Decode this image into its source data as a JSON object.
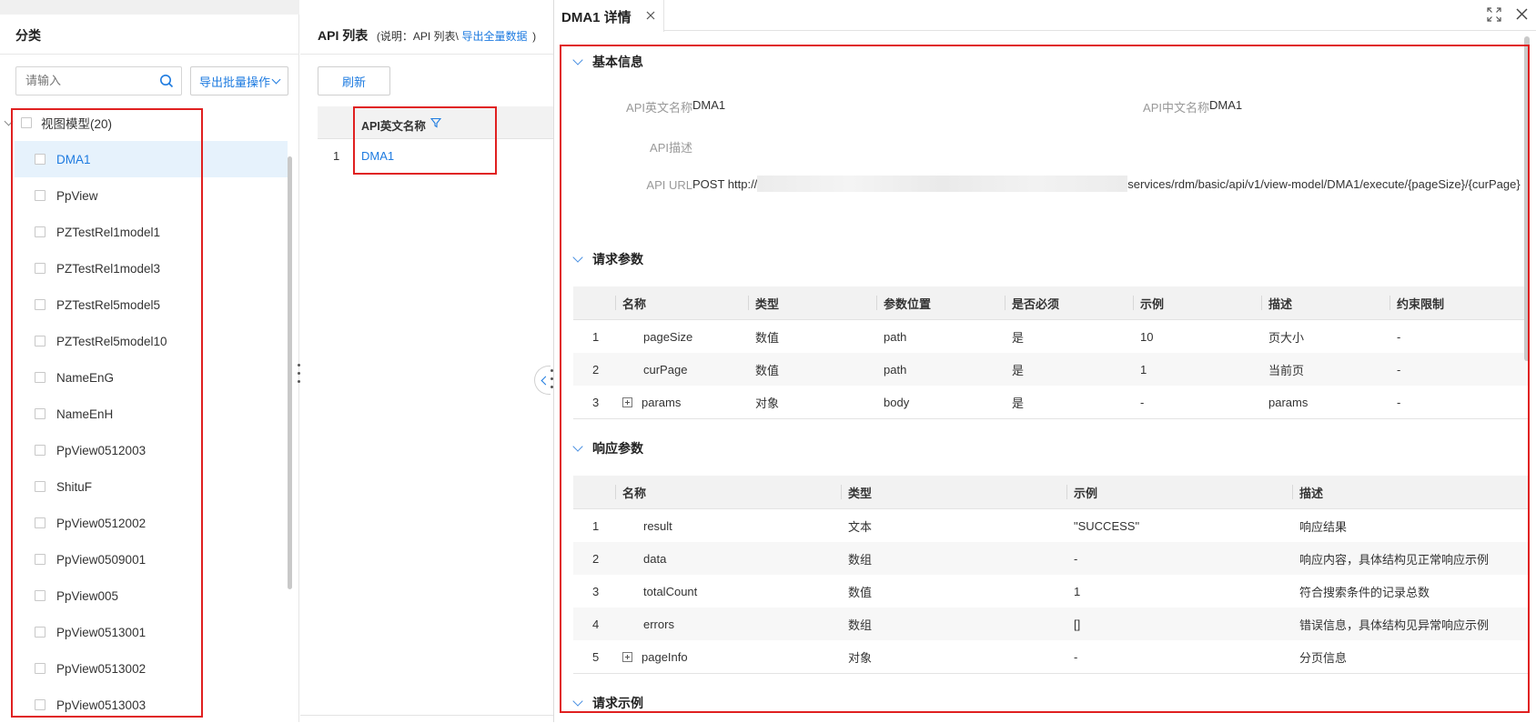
{
  "left_panel": {
    "title": "分类",
    "search_placeholder": "请输入",
    "export_batch_label": "导出批量操作",
    "tree_root_label": "视图模型(20)",
    "tree_items": [
      "DMA1",
      "PpView",
      "PZTestRel1model1",
      "PZTestRel1model3",
      "PZTestRel5model5",
      "PZTestRel5model10",
      "NameEnG",
      "NameEnH",
      "PpView0512003",
      "ShituF",
      "PpView0512002",
      "PpView0509001",
      "PpView005",
      "PpView0513001",
      "PpView0513002",
      "PpView0513003"
    ]
  },
  "middle_panel": {
    "title": "API 列表",
    "note_prefix": "(说明：API 列表\\",
    "note_link": "导出全量数据",
    "note_suffix": ")",
    "refresh_label": "刷新",
    "column_header": "API英文名称",
    "rows": [
      {
        "index": "1",
        "name": "DMA1"
      }
    ]
  },
  "detail_panel": {
    "tab_title": "DMA1 详情",
    "basic": {
      "title": "基本信息",
      "api_en_label": "API英文名称",
      "api_en_value": "DMA1",
      "api_cn_label": "API中文名称",
      "api_cn_value": "DMA1",
      "api_desc_label": "API描述",
      "api_url_label": "API URL",
      "api_url_prefix": "POST http://",
      "api_url_suffix": "services/rdm/basic/api/v1/view-model/DMA1/execute/{pageSize}/{curPage}"
    },
    "request": {
      "title": "请求参数",
      "headers": [
        "名称",
        "类型",
        "参数位置",
        "是否必须",
        "示例",
        "描述",
        "约束限制"
      ],
      "rows": [
        {
          "idx": "1",
          "name": "pageSize",
          "type": "数值",
          "location": "path",
          "required": "是",
          "example": "10",
          "desc": "页大小",
          "constraint": "-",
          "expandable": false
        },
        {
          "idx": "2",
          "name": "curPage",
          "type": "数值",
          "location": "path",
          "required": "是",
          "example": "1",
          "desc": "当前页",
          "constraint": "-",
          "expandable": false
        },
        {
          "idx": "3",
          "name": "params",
          "type": "对象",
          "location": "body",
          "required": "是",
          "example": "-",
          "desc": "params",
          "constraint": "-",
          "expandable": true
        }
      ]
    },
    "response": {
      "title": "响应参数",
      "headers": [
        "名称",
        "类型",
        "示例",
        "描述"
      ],
      "rows": [
        {
          "idx": "1",
          "name": "result",
          "type": "文本",
          "example": "\"SUCCESS\"",
          "desc": "响应结果",
          "expandable": false
        },
        {
          "idx": "2",
          "name": "data",
          "type": "数组",
          "example": "-",
          "desc": "响应内容，具体结构见正常响应示例",
          "expandable": false
        },
        {
          "idx": "3",
          "name": "totalCount",
          "type": "数值",
          "example": "1",
          "desc": "符合搜索条件的记录总数",
          "expandable": false
        },
        {
          "idx": "4",
          "name": "errors",
          "type": "数组",
          "example": "[]",
          "desc": "错误信息，具体结构见异常响应示例",
          "expandable": false
        },
        {
          "idx": "5",
          "name": "pageInfo",
          "type": "对象",
          "example": "-",
          "desc": "分页信息",
          "expandable": true
        }
      ]
    },
    "request_example": {
      "title": "请求示例"
    }
  },
  "colors": {
    "accent": "#1e7be0",
    "highlight_border": "#e02020",
    "selected_bg": "#e6f2fc"
  }
}
